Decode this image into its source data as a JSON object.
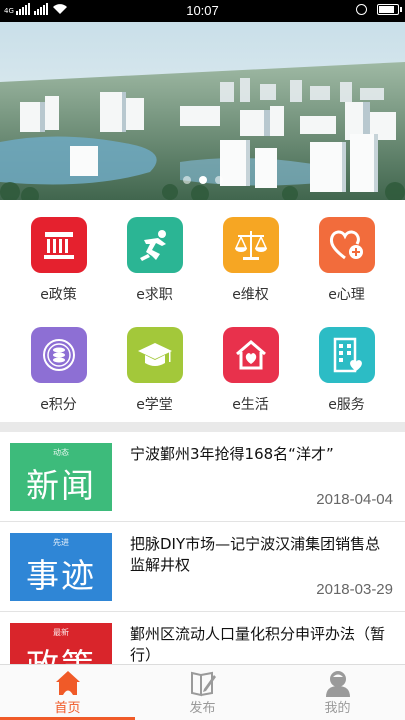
{
  "status_bar": {
    "time": "10:07",
    "carrier_label": "4G",
    "battery_level": 0.9
  },
  "banner": {
    "slide_count": 3,
    "active_slide": 1
  },
  "services": [
    {
      "label": "e政策",
      "icon": "policy-building-icon",
      "color": "#e5212e"
    },
    {
      "label": "e求职",
      "icon": "job-runner-icon",
      "color": "#2bb594"
    },
    {
      "label": "e维权",
      "icon": "justice-scale-icon",
      "color": "#f6a623"
    },
    {
      "label": "e心理",
      "icon": "heart-plus-icon",
      "color": "#f26c3c"
    },
    {
      "label": "e积分",
      "icon": "points-coins-icon",
      "color": "#8d6fd4"
    },
    {
      "label": "e学堂",
      "icon": "graduation-cap-icon",
      "color": "#a3c83a"
    },
    {
      "label": "e生活",
      "icon": "home-heart-icon",
      "color": "#e8314c"
    },
    {
      "label": "e服务",
      "icon": "service-building-icon",
      "color": "#2cbcc5"
    }
  ],
  "news": [
    {
      "title": "宁波鄞州3年抢得168名“洋才”",
      "date": "2018-04-04",
      "thumb_small": "动态",
      "thumb_big": "新闻",
      "thumb_color": "#3dbb7b"
    },
    {
      "title": "把脉DIY市场—记宁波汉浦集团销售总监解井权",
      "date": "2018-03-29",
      "thumb_small": "先进",
      "thumb_big": "事迹",
      "thumb_color": "#2f86d6"
    },
    {
      "title": "鄞州区流动人口量化积分申评办法（暂行）",
      "date": "",
      "thumb_small": "最新",
      "thumb_big": "政策",
      "thumb_color": "#d9252b"
    }
  ],
  "tabs": [
    {
      "label": "首页",
      "icon": "home-icon",
      "active": true
    },
    {
      "label": "发布",
      "icon": "publish-book-icon",
      "active": false
    },
    {
      "label": "我的",
      "icon": "profile-icon",
      "active": false
    }
  ],
  "colors": {
    "accent": "#f05a28",
    "inactive": "#9a9a9a"
  }
}
